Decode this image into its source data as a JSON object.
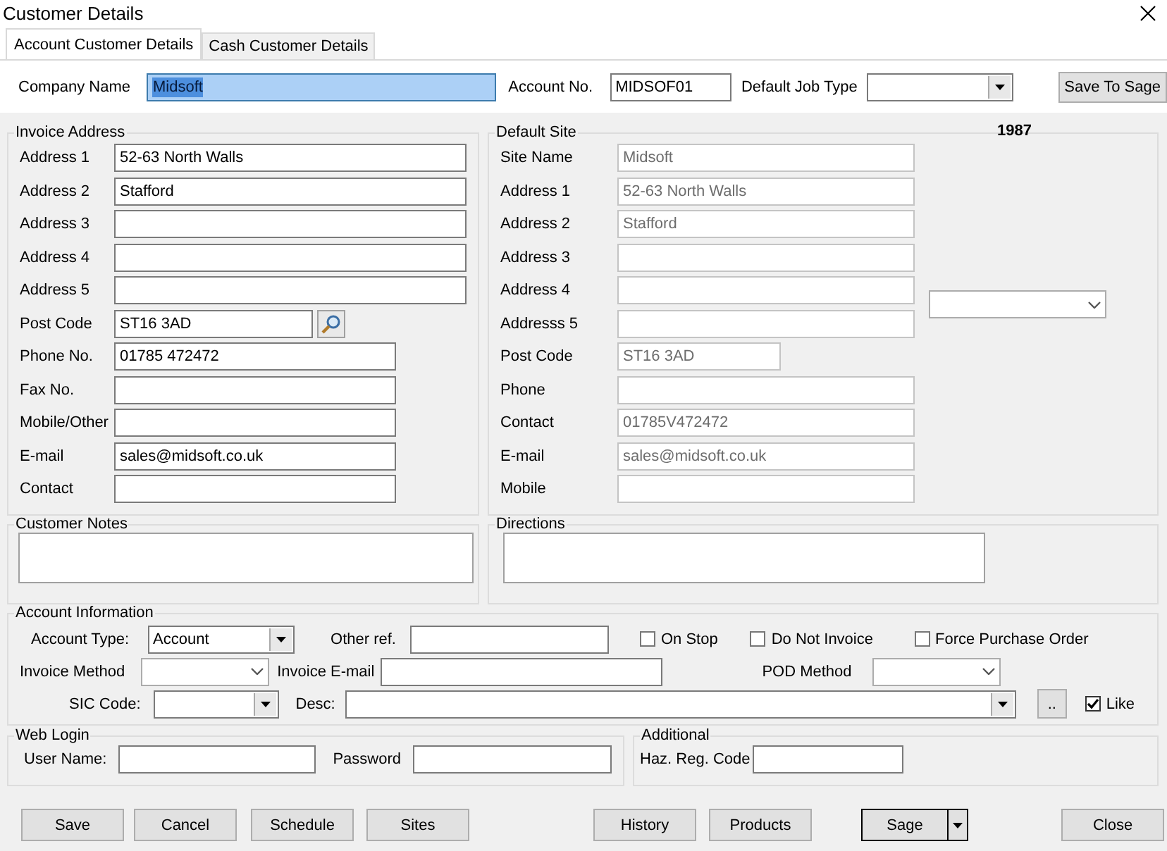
{
  "window": {
    "title": "Customer Details"
  },
  "tabs": [
    {
      "label": "Account Customer Details",
      "selected": true
    },
    {
      "label": "Cash Customer Details",
      "selected": false
    }
  ],
  "header": {
    "company_name": {
      "label": "Company Name",
      "value": "Midsoft",
      "text_selected": true
    },
    "account_no": {
      "label": "Account No.",
      "value": "MIDSOF01"
    },
    "default_job_type": {
      "label": "Default Job Type"
    },
    "save_button": "Save To Sage"
  },
  "site_number": "1987",
  "invoice_address": {
    "title": "Invoice Address",
    "fields": [
      {
        "label": "Address 1",
        "value": "52-63 North Walls",
        "kind": "long"
      },
      {
        "label": "Address 2",
        "value": "Stafford",
        "kind": "long"
      },
      {
        "label": "Address 3",
        "kind": "long"
      },
      {
        "label": "Address 4",
        "kind": "long"
      },
      {
        "label": "Address 5",
        "kind": "long"
      },
      {
        "label": "Post Code",
        "value": "ST16 3AD",
        "kind": "lookup"
      },
      {
        "label": "Phone No.",
        "value": "01785 472472",
        "kind": "medium"
      },
      {
        "label": "Fax No.",
        "kind": "medium"
      },
      {
        "label": "Mobile/Other",
        "kind": "medium"
      },
      {
        "label": "E-mail",
        "value": "sales@midsoft.co.uk",
        "kind": "medium"
      },
      {
        "label": "Contact",
        "kind": "medium"
      }
    ]
  },
  "default_site": {
    "title": "Default Site",
    "readonly": true,
    "fields": [
      {
        "label": "Site Name",
        "value": "Midsoft",
        "kind": "long"
      },
      {
        "label": "Address 1",
        "value": "52-63 North Walls",
        "kind": "long"
      },
      {
        "label": "Address 2",
        "value": "Stafford",
        "kind": "long"
      },
      {
        "label": "Address 3",
        "kind": "long"
      },
      {
        "label": "Address 4",
        "kind": "long"
      },
      {
        "label": "Addresss 5",
        "kind": "long"
      },
      {
        "label": "Post Code",
        "value": "ST16 3AD",
        "kind": "short"
      },
      {
        "label": "Phone",
        "kind": "long"
      },
      {
        "label": "Contact",
        "value": "01785V472472",
        "kind": "long"
      },
      {
        "label": "E-mail",
        "value": "sales@midsoft.co.uk",
        "kind": "long"
      },
      {
        "label": "Mobile",
        "kind": "long"
      }
    ]
  },
  "customer_notes": {
    "title": "Customer Notes"
  },
  "directions": {
    "title": "Directions"
  },
  "account_information": {
    "title": "Account Information",
    "account_type": {
      "label": "Account Type:",
      "value": "Account"
    },
    "other_ref": {
      "label": "Other ref."
    },
    "checks": [
      {
        "label": "On Stop",
        "checked": false
      },
      {
        "label": "Do Not Invoice",
        "checked": false
      },
      {
        "label": "Force Purchase Order",
        "checked": false
      }
    ],
    "invoice_method": {
      "label": "Invoice Method"
    },
    "invoice_email": {
      "label": "Invoice E-mail"
    },
    "pod_method": {
      "label": "POD Method"
    },
    "sic_code": {
      "label": "SIC Code:"
    },
    "desc": {
      "label": "Desc:"
    },
    "more_button": "..",
    "like": {
      "label": "Like",
      "checked": true
    }
  },
  "web_login": {
    "title": "Web Login",
    "user_name": {
      "label": "User Name:"
    },
    "password": {
      "label": "Password"
    }
  },
  "additional": {
    "title": "Additional",
    "haz_reg_code": {
      "label": "Haz. Reg. Code"
    }
  },
  "footer": {
    "left": [
      "Save",
      "Cancel",
      "Schedule",
      "Sites"
    ],
    "middle": [
      "History",
      "Products"
    ],
    "split_button": "Sage",
    "close": "Close"
  }
}
